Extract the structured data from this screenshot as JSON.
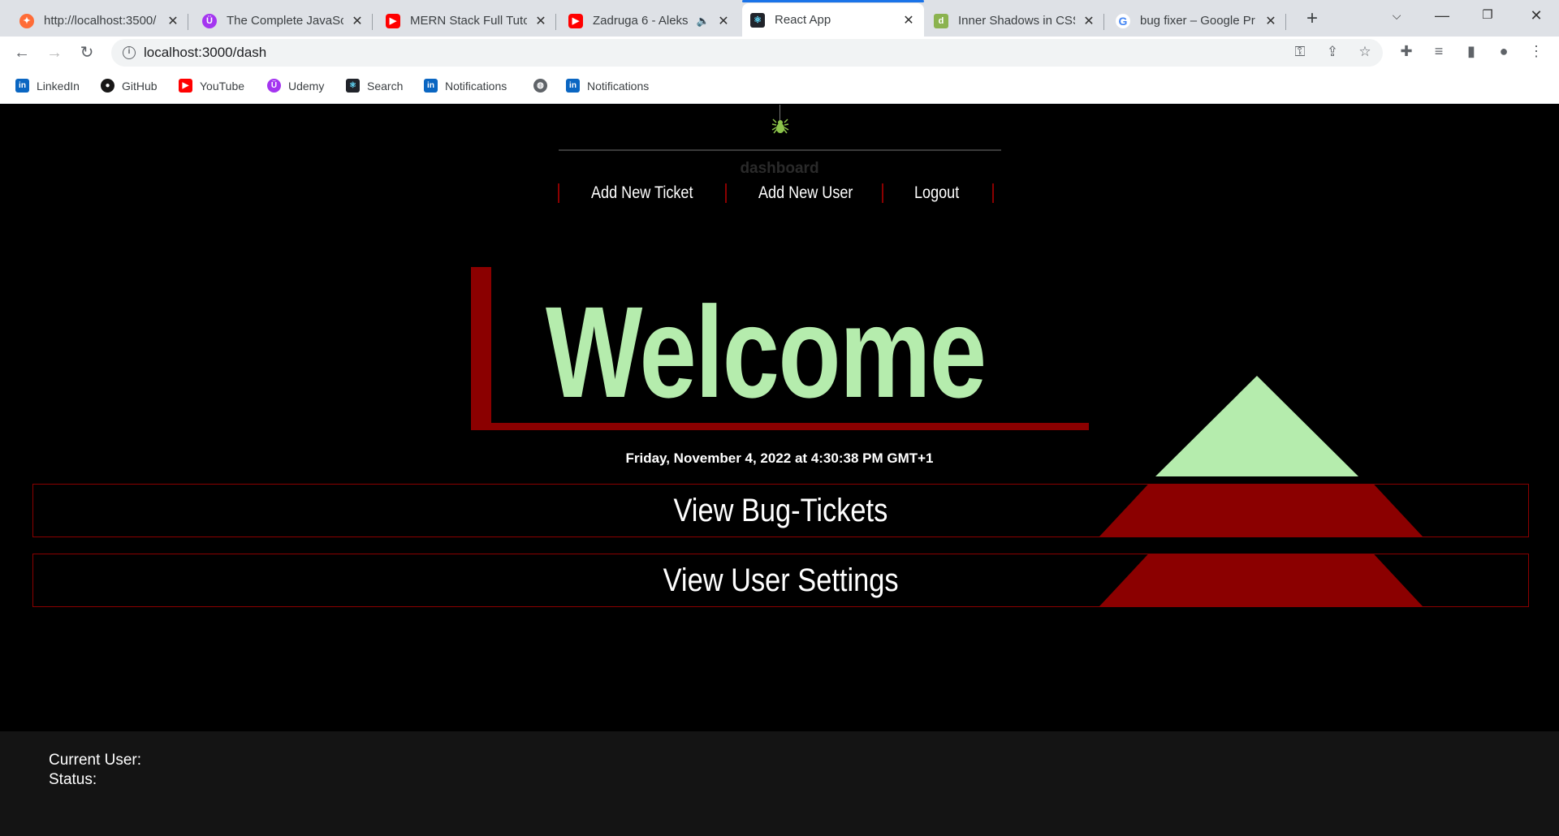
{
  "browser": {
    "tabs": [
      {
        "title": "http://localhost:3500/",
        "icon": "postman-icon"
      },
      {
        "title": "The Complete JavaScr",
        "icon": "udemy-icon"
      },
      {
        "title": "MERN Stack Full Tutor",
        "icon": "youtube-icon"
      },
      {
        "title": "Zadruga 6 - Aleks",
        "icon": "youtube-icon"
      },
      {
        "title": "React App",
        "icon": "react-icon"
      },
      {
        "title": "Inner Shadows in CSS",
        "icon": "d-icon"
      },
      {
        "title": "bug fixer – Google Pr",
        "icon": "google-icon"
      }
    ],
    "url": "localhost:3000/dash",
    "bookmarks": [
      {
        "label": "LinkedIn",
        "icon": "linkedin-icon"
      },
      {
        "label": "GitHub",
        "icon": "github-icon"
      },
      {
        "label": "YouTube",
        "icon": "youtube-icon"
      },
      {
        "label": "Udemy",
        "icon": "udemy-icon"
      },
      {
        "label": "Search",
        "icon": "react-icon"
      },
      {
        "label": "Notifications",
        "icon": "linkedin-icon"
      },
      {
        "label": "",
        "icon": "globe-icon"
      },
      {
        "label": "Notifications",
        "icon": "linkedin-icon"
      }
    ]
  },
  "header": {
    "section_label": "dashboard",
    "nav": {
      "add_ticket": "Add New Ticket",
      "add_user": "Add New User",
      "logout": "Logout"
    }
  },
  "main": {
    "welcome": "Welcome",
    "datetime": "Friday, November 4, 2022 at 4:30:38 PM GMT+1",
    "view_tickets": "View Bug-Tickets",
    "view_settings": "View User Settings"
  },
  "footer": {
    "current_user_label": "Current User:",
    "status_label": "Status:"
  },
  "colors": {
    "accent_red": "#8b0000",
    "accent_green": "#b5ecad",
    "background": "#000000",
    "footer_bg": "#141414"
  }
}
